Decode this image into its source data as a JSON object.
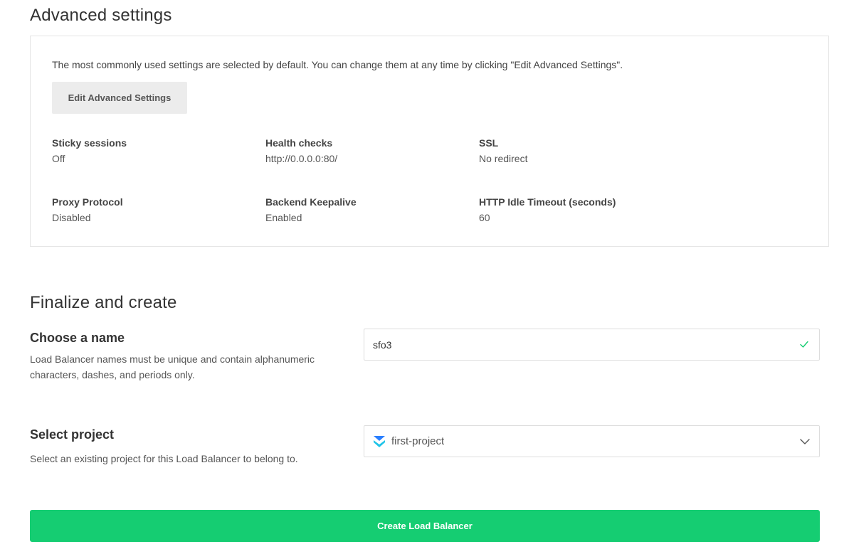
{
  "advanced": {
    "title": "Advanced settings",
    "description": "The most commonly used settings are selected by default. You can change them at any time by clicking \"Edit Advanced Settings\".",
    "edit_button": "Edit Advanced Settings",
    "settings": [
      {
        "label": "Sticky sessions",
        "value": "Off"
      },
      {
        "label": "Health checks",
        "value": "http://0.0.0.0:80/"
      },
      {
        "label": "SSL",
        "value": "No redirect"
      },
      {
        "label": "Proxy Protocol",
        "value": "Disabled"
      },
      {
        "label": "Backend Keepalive",
        "value": "Enabled"
      },
      {
        "label": "HTTP Idle Timeout (seconds)",
        "value": "60"
      }
    ]
  },
  "finalize": {
    "title": "Finalize and create",
    "name_section": {
      "title": "Choose a name",
      "description": "Load Balancer names must be unique and contain alphanumeric characters, dashes, and periods only.",
      "value": "sfo3",
      "valid_icon": "check-icon",
      "valid_color": "#15cd72"
    },
    "project_section": {
      "title": "Select project",
      "description": "Select an existing project for this Load Balancer to belong to.",
      "selected": "first-project",
      "project_icon": "project-icon",
      "dropdown_icon": "chevron-down-icon"
    },
    "create_button": "Create Load Balancer",
    "accent_color": "#15cd72"
  }
}
